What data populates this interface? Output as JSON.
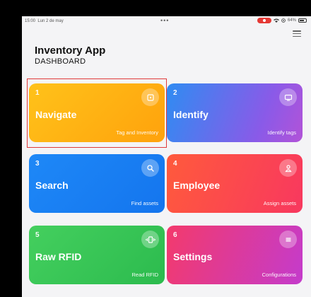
{
  "status_bar": {
    "time": "15:00",
    "date": "Lun 2 de may",
    "dots": "•••",
    "battery": "64%"
  },
  "header": {
    "title": "Inventory App",
    "subtitle": "DASHBOARD"
  },
  "cards": [
    {
      "number": "1",
      "title": "Navigate",
      "description": "Tag and Inventory",
      "icon": "nfc-tag-icon"
    },
    {
      "number": "2",
      "title": "Identify",
      "description": "Identify tags",
      "icon": "screen-icon"
    },
    {
      "number": "3",
      "title": "Search",
      "description": "Find assets",
      "icon": "search-icon"
    },
    {
      "number": "4",
      "title": "Employee",
      "description": "Assign assets",
      "icon": "person-icon"
    },
    {
      "number": "5",
      "title": "Raw RFID",
      "description": "Read RFID",
      "icon": "vibrate-icon"
    },
    {
      "number": "6",
      "title": "Settings",
      "description": "Configurations",
      "icon": "list-icon"
    }
  ],
  "colors": {
    "navigate": "#ffb414",
    "identify": "#6b6ff0",
    "search": "#1a80f2",
    "employee": "#fb4a4e",
    "raw_rfid": "#3cc557",
    "settings": "#e03b9a",
    "highlight": "#e03a3a"
  }
}
